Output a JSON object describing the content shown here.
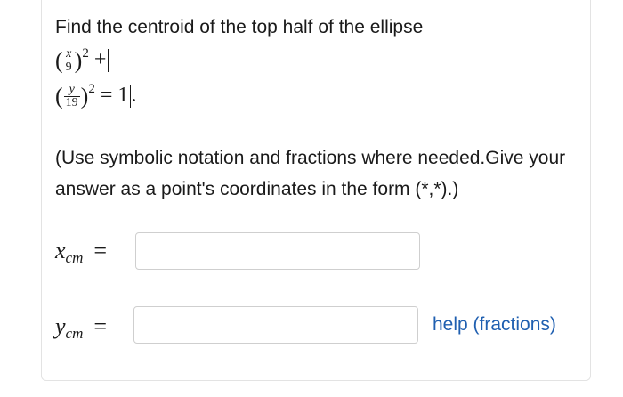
{
  "question": {
    "prompt": "Find the centroid of the top half of the ellipse",
    "eq_line1": {
      "open": "(",
      "num": "x",
      "den": "9",
      "close": ")",
      "exp": "2",
      "op": " +"
    },
    "eq_line2": {
      "open": "(",
      "num": "y",
      "den": "19",
      "close": ")",
      "exp": "2",
      "rhs": " = 1",
      "period": "."
    }
  },
  "instruction": "(Use symbolic notation and fractions where needed.Give your answer as a point's coordinates in the form (*,*).)",
  "answers": {
    "x_cm": {
      "var": "x",
      "sub": "cm",
      "equals": "=",
      "value": "",
      "placeholder": ""
    },
    "y_cm": {
      "var": "y",
      "sub": "cm",
      "equals": "=",
      "value": "",
      "placeholder": ""
    }
  },
  "help_link": "help (fractions)",
  "colors": {
    "link": "#1f5fb0",
    "border": "#cfcfcf",
    "text": "#1a1a1a"
  }
}
